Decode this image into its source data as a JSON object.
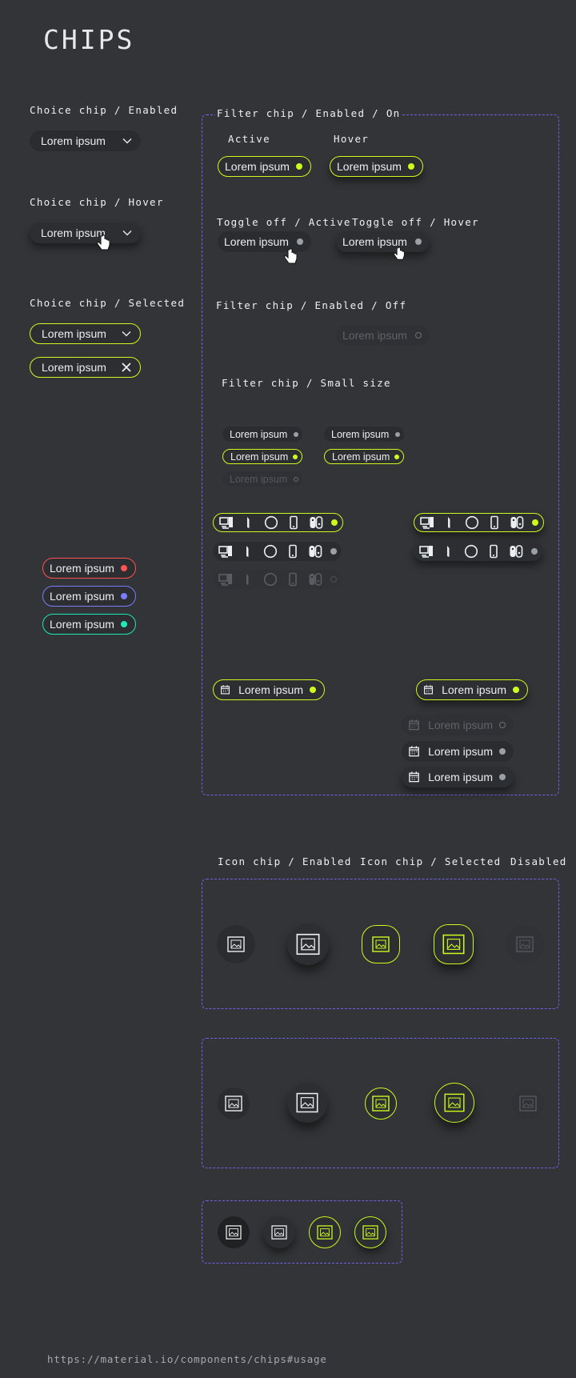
{
  "page_title": "CHIPS",
  "chip_text": "Lorem ipsum",
  "labels": {
    "choice_enabled": "Choice chip / Enabled",
    "choice_hover": "Choice chip / Hover",
    "choice_selected": "Choice chip / Selected",
    "filter_enabled_on": "Filter chip / Enabled / On",
    "active": "Active",
    "hover": "Hover",
    "toggle_off_active": "Toggle off / Active",
    "toggle_off_hover": "Toggle off / Hover",
    "filter_enabled_off": "Filter chip / Enabled / Off",
    "filter_small": "Filter chip / Small size",
    "icon_chip_enabled": "Icon chip / Enabled",
    "icon_chip_selected": "Icon chip / Selected",
    "disabled": "Disabled"
  },
  "colors": {
    "background": "#323437",
    "accent": "#cdfa1f",
    "dashed_frame": "#6d63e8",
    "red": "#ff5252",
    "blue": "#7b7cff",
    "cyan": "#1de9b6"
  },
  "platform_icons": [
    "pc-icon",
    "playstation-icon",
    "xbox-icon",
    "mobile-icon",
    "switch-icon"
  ],
  "footer_url": "https://material.io/components/chips#usage"
}
